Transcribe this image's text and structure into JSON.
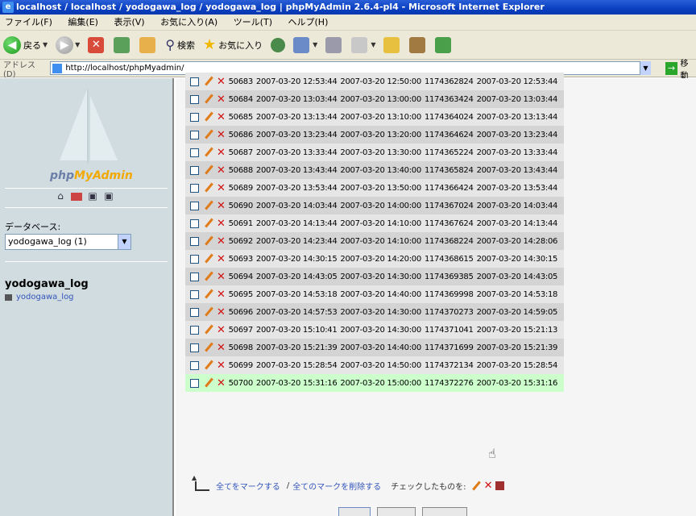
{
  "window": {
    "title": "localhost / localhost / yodogawa_log / yodogawa_log | phpMyAdmin 2.6.4-pl4 - Microsoft Internet Explorer"
  },
  "menu": [
    "ファイル(F)",
    "編集(E)",
    "表示(V)",
    "お気に入り(A)",
    "ツール(T)",
    "ヘルプ(H)"
  ],
  "toolbar": {
    "back": "戻る",
    "search": "検索",
    "favorites": "お気に入り"
  },
  "address": {
    "label": "アドレス(D)",
    "url": "http://localhost/phpMyadmin/",
    "go": "移動"
  },
  "sidebar": {
    "logo_a": "php",
    "logo_b": "MyAdmin",
    "db_label": "データベース:",
    "db_selected": "yodogawa_log (1)",
    "db_name": "yodogawa_log",
    "table_link": "yodogawa_log"
  },
  "rows": [
    [
      "50683",
      "2007-03-20 12:53:44",
      "2007-03-20 12:50:00",
      "1174362824",
      "2007-03-20 12:53:44"
    ],
    [
      "50684",
      "2007-03-20 13:03:44",
      "2007-03-20 13:00:00",
      "1174363424",
      "2007-03-20 13:03:44"
    ],
    [
      "50685",
      "2007-03-20 13:13:44",
      "2007-03-20 13:10:00",
      "1174364024",
      "2007-03-20 13:13:44"
    ],
    [
      "50686",
      "2007-03-20 13:23:44",
      "2007-03-20 13:20:00",
      "1174364624",
      "2007-03-20 13:23:44"
    ],
    [
      "50687",
      "2007-03-20 13:33:44",
      "2007-03-20 13:30:00",
      "1174365224",
      "2007-03-20 13:33:44"
    ],
    [
      "50688",
      "2007-03-20 13:43:44",
      "2007-03-20 13:40:00",
      "1174365824",
      "2007-03-20 13:43:44"
    ],
    [
      "50689",
      "2007-03-20 13:53:44",
      "2007-03-20 13:50:00",
      "1174366424",
      "2007-03-20 13:53:44"
    ],
    [
      "50690",
      "2007-03-20 14:03:44",
      "2007-03-20 14:00:00",
      "1174367024",
      "2007-03-20 14:03:44"
    ],
    [
      "50691",
      "2007-03-20 14:13:44",
      "2007-03-20 14:10:00",
      "1174367624",
      "2007-03-20 14:13:44"
    ],
    [
      "50692",
      "2007-03-20 14:23:44",
      "2007-03-20 14:10:00",
      "1174368224",
      "2007-03-20 14:28:06"
    ],
    [
      "50693",
      "2007-03-20 14:30:15",
      "2007-03-20 14:20:00",
      "1174368615",
      "2007-03-20 14:30:15"
    ],
    [
      "50694",
      "2007-03-20 14:43:05",
      "2007-03-20 14:30:00",
      "1174369385",
      "2007-03-20 14:43:05"
    ],
    [
      "50695",
      "2007-03-20 14:53:18",
      "2007-03-20 14:40:00",
      "1174369998",
      "2007-03-20 14:53:18"
    ],
    [
      "50696",
      "2007-03-20 14:57:53",
      "2007-03-20 14:30:00",
      "1174370273",
      "2007-03-20 14:59:05"
    ],
    [
      "50697",
      "2007-03-20 15:10:41",
      "2007-03-20 14:30:00",
      "1174371041",
      "2007-03-20 15:21:13"
    ],
    [
      "50698",
      "2007-03-20 15:21:39",
      "2007-03-20 14:40:00",
      "1174371699",
      "2007-03-20 15:21:39"
    ],
    [
      "50699",
      "2007-03-20 15:28:54",
      "2007-03-20 14:50:00",
      "1174372134",
      "2007-03-20 15:28:54"
    ],
    [
      "50700",
      "2007-03-20 15:31:16",
      "2007-03-20 15:00:00",
      "1174372276",
      "2007-03-20 15:31:16"
    ]
  ],
  "actions": {
    "check_all": "全てをマークする",
    "separator": "/",
    "uncheck_all": "全てのマークを削除する",
    "with_selected": "チェックしたものを:"
  }
}
